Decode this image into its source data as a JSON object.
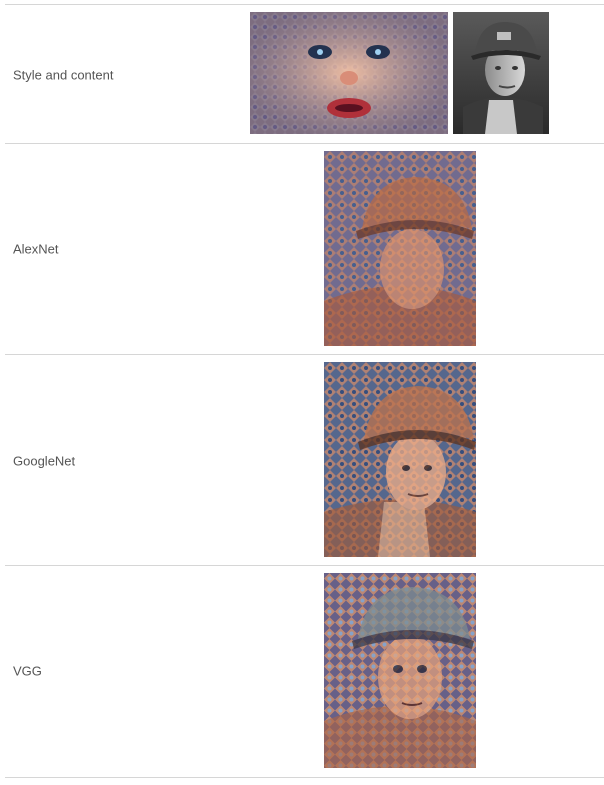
{
  "rows": [
    {
      "label": "Style and content",
      "images": [
        "chuck-close-style-portrait",
        "soldier-helmet-photo"
      ]
    },
    {
      "label": "AlexNet",
      "images": [
        "alexnet-stylized-soldier"
      ]
    },
    {
      "label": "GoogleNet",
      "images": [
        "googlenet-stylized-soldier"
      ]
    },
    {
      "label": "VGG",
      "images": [
        "vgg-stylized-soldier"
      ]
    }
  ]
}
